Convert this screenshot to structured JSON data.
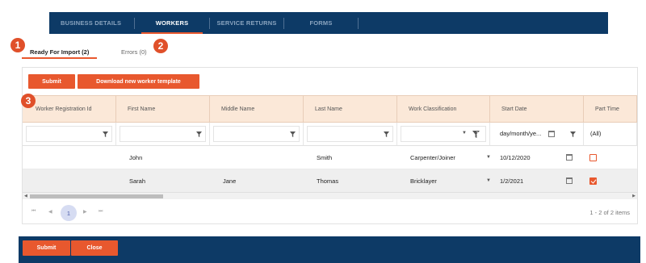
{
  "topnav": {
    "tabs": [
      {
        "label": "BUSINESS DETAILS"
      },
      {
        "label": "WORKERS"
      },
      {
        "label": "SERVICE RETURNS"
      },
      {
        "label": "FORMS"
      }
    ],
    "active": "WORKERS"
  },
  "subtabs": {
    "ready": "Ready For Import (2)",
    "errors": "Errors (0)"
  },
  "badges": [
    "1",
    "2",
    "3"
  ],
  "toolbar": {
    "submit_label": "Submit",
    "download_label": "Download new worker template"
  },
  "grid": {
    "columns": [
      "Worker Registration Id",
      "First Name",
      "Middle Name",
      "Last Name",
      "Work Classification",
      "Start Date",
      "Part Time"
    ],
    "filters": {
      "start_date_placeholder": "day/month/ye...",
      "part_time_value": "(All)"
    },
    "rows": [
      {
        "worker_registration_id": "",
        "first_name": "John",
        "middle_name": "",
        "last_name": "Smith",
        "work_classification": "Carpenter/Joiner",
        "start_date": "10/12/2020",
        "part_time": false
      },
      {
        "worker_registration_id": "",
        "first_name": "Sarah",
        "middle_name": "Jane",
        "last_name": "Thomas",
        "work_classification": "Bricklayer",
        "start_date": "1/2/2021",
        "part_time": true
      }
    ]
  },
  "pager": {
    "current_page": "1",
    "info": "1 - 2 of 2 items"
  },
  "footer": {
    "submit_label": "Submit",
    "close_label": "Close"
  },
  "colors": {
    "navy": "#0d3a66",
    "accent": "#e8582e",
    "header_bg": "#fbe8d8"
  }
}
